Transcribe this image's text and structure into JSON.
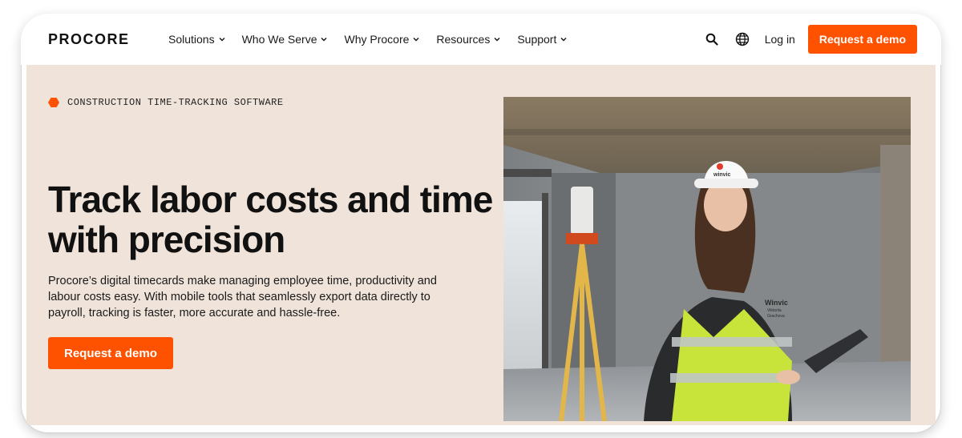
{
  "nav": {
    "logo": "PROCORE",
    "menu": [
      {
        "label": "Solutions"
      },
      {
        "label": "Who We Serve"
      },
      {
        "label": "Why Procore"
      },
      {
        "label": "Resources"
      },
      {
        "label": "Support"
      }
    ],
    "search_icon": "search-icon",
    "language_icon": "globe-icon",
    "login_label": "Log in",
    "cta_label": "Request a demo"
  },
  "hero": {
    "eyebrow": "CONSTRUCTION TIME-TRACKING SOFTWARE",
    "headline": "Track labor costs and time with precision",
    "body": "Procore’s digital timecards make managing employee time, productivity and labour costs easy. With mobile tools that seamlessly export data directly to payroll, tracking is faster, more accurate and hassle-free.",
    "cta_label": "Request a demo",
    "image_helmet_text": "winvic",
    "image_vest_text": "Winvic",
    "image_vest_name_1": "Viktoriia",
    "image_vest_name_2": "Grachova"
  },
  "colors": {
    "accent": "#ff5200",
    "hero_bg": "#efe3da"
  }
}
